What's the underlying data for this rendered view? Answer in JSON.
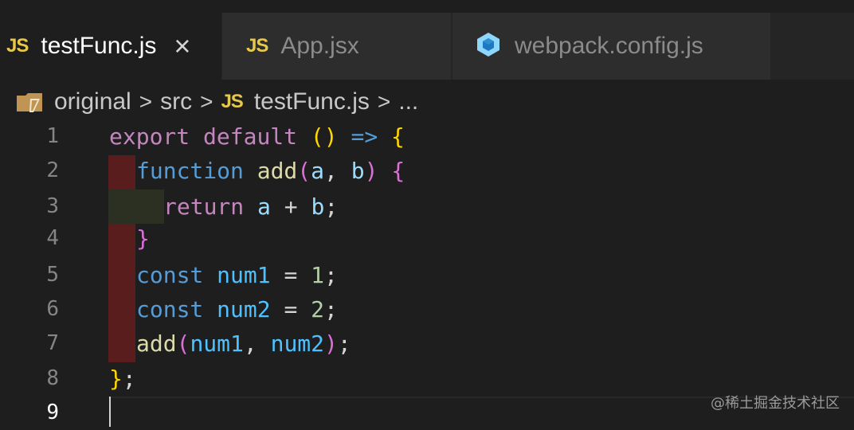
{
  "tabs": [
    {
      "icon": "js-icon",
      "label": "testFunc.js",
      "active": true,
      "close": "×"
    },
    {
      "icon": "js-icon",
      "label": "App.jsx",
      "active": false
    },
    {
      "icon": "webpack-icon",
      "label": "webpack.config.js",
      "active": false
    }
  ],
  "icons": {
    "js": "JS"
  },
  "breadcrumb": {
    "items": [
      "original",
      "src",
      "testFunc.js",
      "..."
    ],
    "separator": ">"
  },
  "editor": {
    "line_numbers": [
      "1",
      "2",
      "3",
      "4",
      "5",
      "6",
      "7",
      "8",
      "9"
    ],
    "current_line": 9,
    "lines": [
      "export default () => {",
      "  function add(a, b) {",
      "    return a + b;",
      "  }",
      "  const num1 = 1;",
      "  const num2 = 2;",
      "  add(num1, num2);",
      "};",
      ""
    ]
  },
  "colors": {
    "background": "#1e1e1e",
    "tab_bar": "#252526",
    "js_icon": "#e8c84a",
    "keyword_purple": "#c586c0",
    "keyword_blue": "#569cd6",
    "diff_removed": "#5a1d1d"
  },
  "watermark": "@稀土掘金技术社区"
}
